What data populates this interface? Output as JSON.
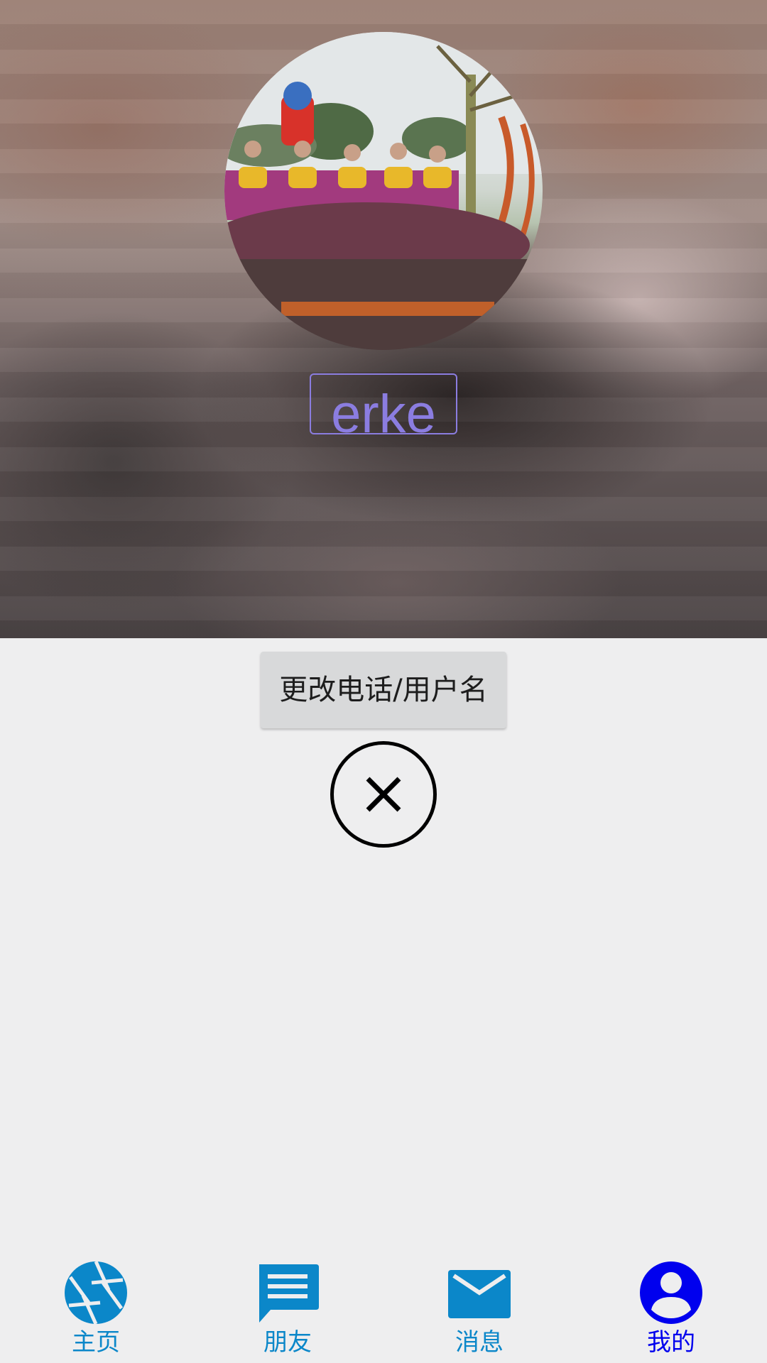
{
  "profile": {
    "username": "erke"
  },
  "actions": {
    "change_label": "更改电话/用户名"
  },
  "bottom_nav": {
    "items": [
      {
        "label": "主页",
        "icon": "aperture-icon",
        "active": false
      },
      {
        "label": "朋友",
        "icon": "chat-icon",
        "active": false
      },
      {
        "label": "消息",
        "icon": "mail-icon",
        "active": false
      },
      {
        "label": "我的",
        "icon": "account-icon",
        "active": true
      }
    ]
  },
  "colors": {
    "nav_inactive": "#0b87c9",
    "nav_active": "#0000ee",
    "username": "#8b7de0",
    "page_background": "#eeeeef"
  }
}
